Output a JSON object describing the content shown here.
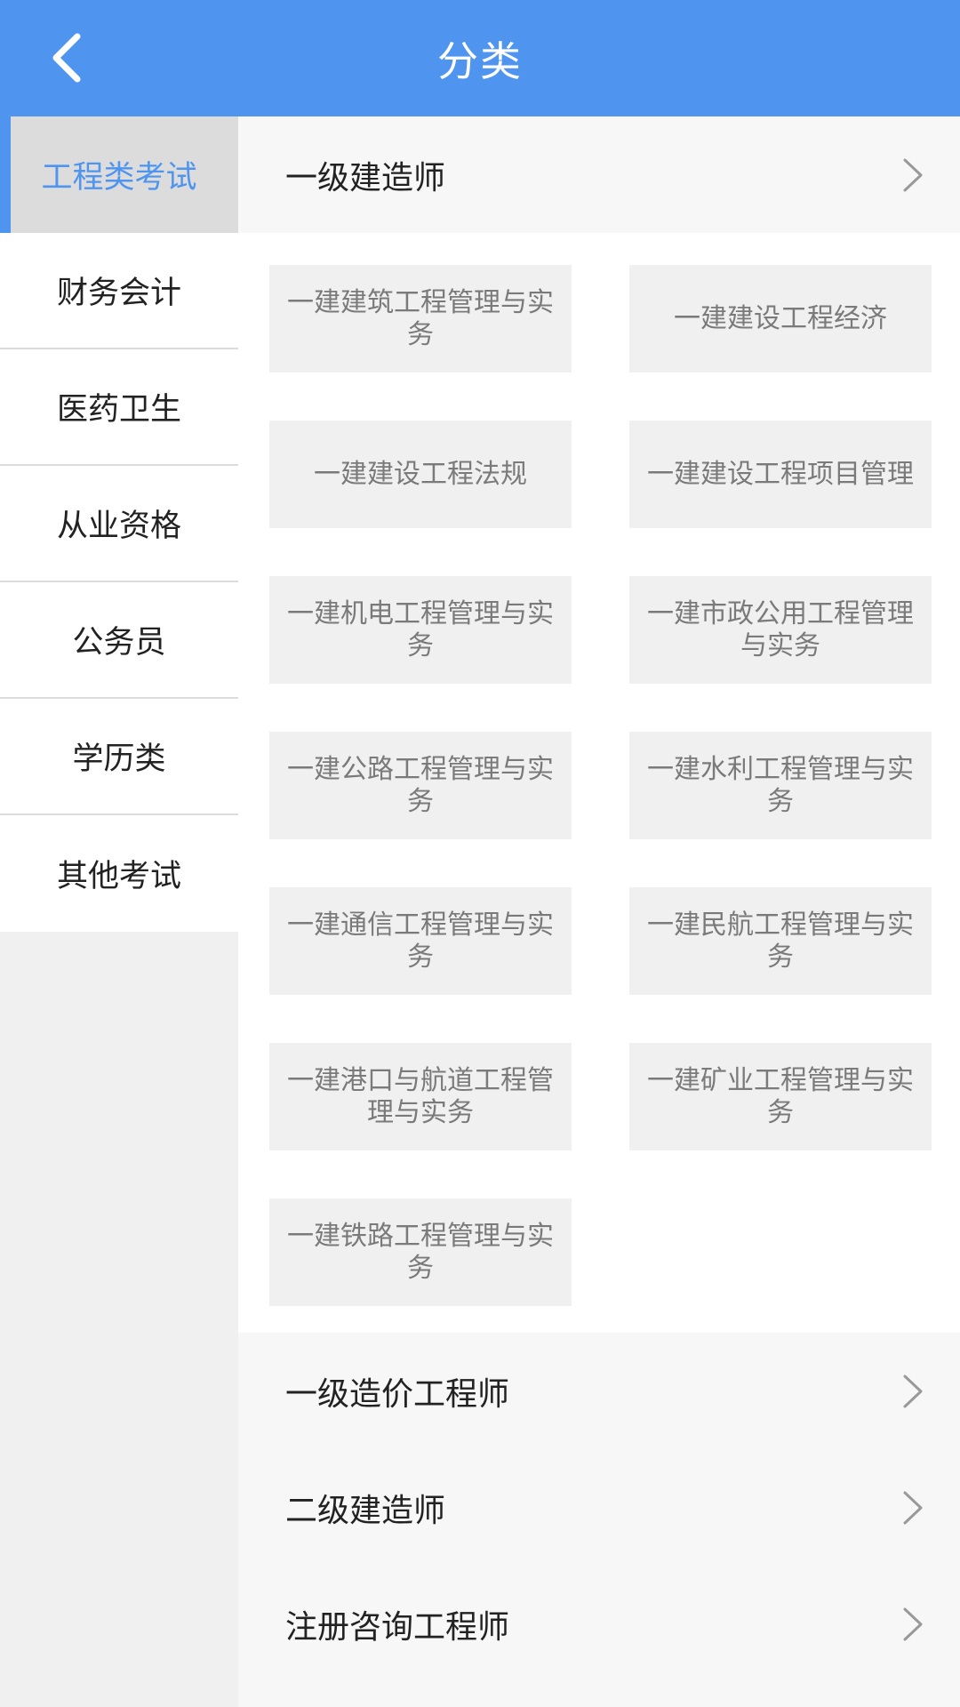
{
  "header": {
    "title": "分类"
  },
  "sidebar": {
    "items": [
      {
        "label": "工程类考试"
      },
      {
        "label": "财务会计"
      },
      {
        "label": "医药卫生"
      },
      {
        "label": "从业资格"
      },
      {
        "label": "公务员"
      },
      {
        "label": "学历类"
      },
      {
        "label": "其他考试"
      }
    ]
  },
  "main": {
    "categories": [
      {
        "label": "一级建造师"
      },
      {
        "label": "一级造价工程师"
      },
      {
        "label": "二级建造师"
      },
      {
        "label": "注册咨询工程师"
      }
    ],
    "subcategories": [
      {
        "label": "一建建筑工程管理与实务"
      },
      {
        "label": "一建建设工程经济"
      },
      {
        "label": "一建建设工程法规"
      },
      {
        "label": "一建建设工程项目管理"
      },
      {
        "label": "一建机电工程管理与实务"
      },
      {
        "label": "一建市政公用工程管理与实务"
      },
      {
        "label": "一建公路工程管理与实务"
      },
      {
        "label": "一建水利工程管理与实务"
      },
      {
        "label": "一建通信工程管理与实务"
      },
      {
        "label": "一建民航工程管理与实务"
      },
      {
        "label": "一建港口与航道工程管理与实务"
      },
      {
        "label": "一建矿业工程管理与实务"
      },
      {
        "label": "一建铁路工程管理与实务"
      }
    ]
  },
  "colors": {
    "accent": "#4f95ef",
    "header_text": "#ffffff",
    "active_sidebar_bg": "#dcdcdc",
    "subcard_bg": "#f0f0f0",
    "subcard_text": "#7a7a7a"
  },
  "icons": {
    "back": "chevron-left-icon",
    "row_arrow": "chevron-right-icon"
  }
}
